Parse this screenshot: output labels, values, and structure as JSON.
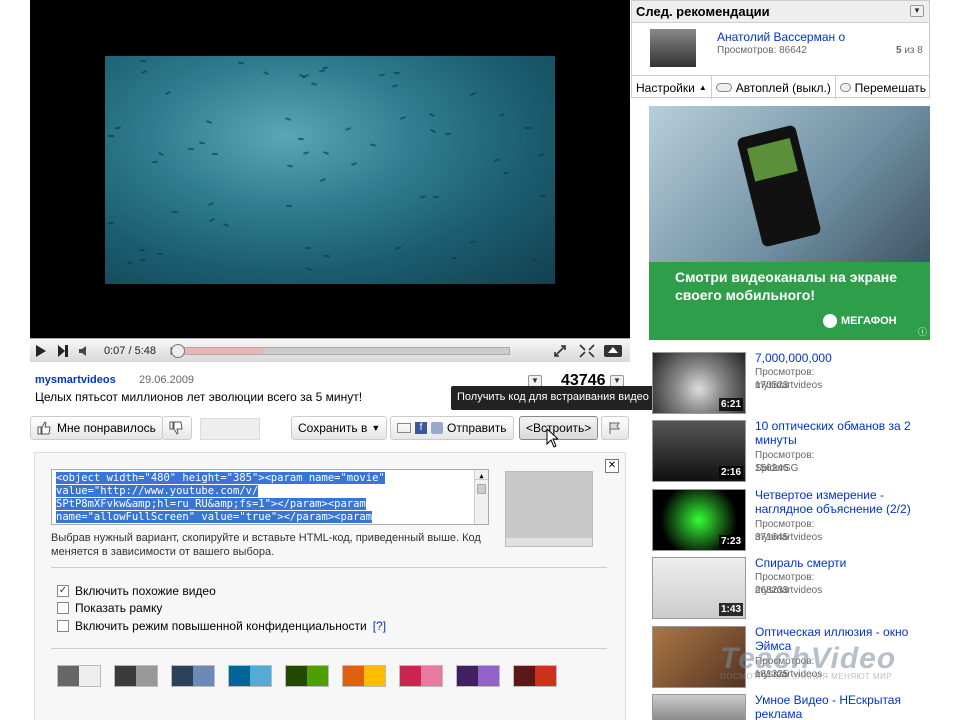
{
  "player": {
    "time": "0:07 / 5:48",
    "progress_played": 0.02,
    "progress_loaded": 0.27
  },
  "video": {
    "uploader": "mysmartvideos",
    "date": "29.06.2009",
    "title": "Целых пятьсот миллионов лет эволюции всего за 5 минут!",
    "views": "43746"
  },
  "tooltip": "Получить код для встраивания видео",
  "actions": {
    "like": "Мне понравилось",
    "save": "Сохранить в",
    "send": "Отправить",
    "embed": "<Встроить>"
  },
  "embed": {
    "code_lines": [
      "<object width=\"480\" height=\"385\"><param name=\"movie\"",
      "value=\"http://www.youtube.com/v/",
      "SPtP8mXFvkw&amp;hl=ru_RU&amp;fs=1\"></param><param",
      "name=\"allowFullScreen\" value=\"true\"></param><param"
    ],
    "help": "Выбрав нужный вариант, скопируйте и вставьте HTML-код, приведенный выше. Код меняется в зависимости от вашего выбора.",
    "options": [
      {
        "label": "Включить похожие видео",
        "checked": true
      },
      {
        "label": "Показать рамку",
        "checked": false
      },
      {
        "label": "Включить режим повышенной конфиденциальности",
        "checked": false,
        "help": "[?]"
      }
    ],
    "close": "✕",
    "swatches": [
      [
        "#666666",
        "#eeeeee"
      ],
      [
        "#3a3a3a",
        "#999999"
      ],
      [
        "#2b405b",
        "#6b8ab6"
      ],
      [
        "#006699",
        "#54abd6"
      ],
      [
        "#234900",
        "#4e9e00"
      ],
      [
        "#e1600f",
        "#febd01"
      ],
      [
        "#cc2550",
        "#e87a9f"
      ],
      [
        "#402061",
        "#9461ca"
      ],
      [
        "#5d1719",
        "#cd311b"
      ]
    ]
  },
  "playlist": {
    "header": "След. рекомендации",
    "item_title": "Анатолий Вассерман о",
    "item_views": "Просмотров: 86642",
    "count_num": "5",
    "count_rest": " из 8",
    "settings": "Настройки",
    "autoplay": "Автоплей (выкл.)",
    "shuffle": "Перемешать"
  },
  "ad": {
    "text": "Смотри видеоканалы на экране своего мобильного!",
    "brand": "МЕГАФОН"
  },
  "related": [
    {
      "title": "7,000,000,000",
      "views": "Просмотров: 170523",
      "author": "mysmartvideos",
      "duration": "6:21"
    },
    {
      "title": "10 оптических обманов за 2 минуты",
      "views": "Просмотров: 156246",
      "author": "SpiderSG",
      "duration": "2:16"
    },
    {
      "title": "Четвертое измерение - наглядное объяснение (2/2)",
      "views": "Просмотров: 371645",
      "author": "mysmartvideos",
      "duration": "7:23"
    },
    {
      "title": "Спираль смерти",
      "views": "Просмотров: 268233",
      "author": "mysmartvideos",
      "duration": "1:43"
    },
    {
      "title": "Оптическая иллюзия - окно Эймса",
      "views": "Просмотров: 181325",
      "author": "mysmartvideos",
      "duration": ""
    },
    {
      "title": "Умное Видео - НЕскрытая реклама",
      "views": "",
      "author": "",
      "duration": ""
    }
  ],
  "watermark": {
    "brand": "TeachVideo",
    "tagline": "ПОСМОТРИ КАК ЗНАНИЯ МЕНЯЮТ МИР"
  }
}
